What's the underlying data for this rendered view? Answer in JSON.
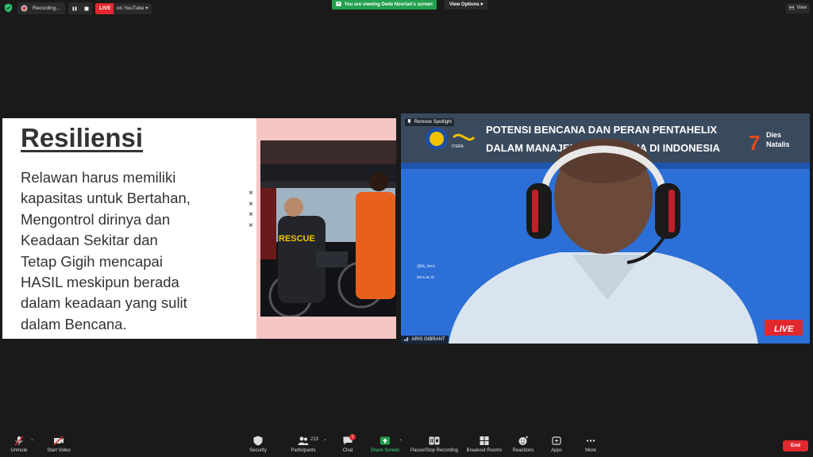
{
  "topbar": {
    "recording_label": "Recording...",
    "pause_icon": "pause-icon",
    "stop_icon": "stop-icon",
    "live_badge": "LIVE",
    "stream_label": "on YouTube",
    "viewing_banner": "You are viewing Dede Novrian's screen",
    "view_options": "View Options",
    "view_button": "View"
  },
  "slide": {
    "title": "Resiliensi",
    "body_lines": [
      "Relawan harus memiliki",
      "kapasitas untuk Bertahan,",
      "Mengontrol dirinya dan",
      "Keadaan Sekitar dan",
      "Tetap Gigih mencapai",
      "HASIL meskipun berada",
      "dalam keadaan yang sulit",
      "dalam Bencana."
    ],
    "bullets": [
      "×",
      "×",
      "×",
      "×"
    ],
    "photo_vest_text": "RESCUE"
  },
  "speaker": {
    "remove_spotlight": "Remove Spotlight",
    "name": "ARIS GIBRANT",
    "banner_line1": "POTENSI BENCANA DAN PERAN PENTAHELIX",
    "banner_line2": "DALAM MANAJEMEN BENCANA DI INDONESIA",
    "logo_text": "ITERA",
    "dies_line1": "Dies",
    "dies_line2": "Natalis",
    "dies_number": "7",
    "social1": "@itk_itera",
    "social2": "itera.ac.id",
    "live_badge": "LIVE"
  },
  "toolbar": {
    "unmute": "Unmute",
    "start_video": "Start Video",
    "security": "Security",
    "participants": "Participants",
    "participants_count": "213",
    "chat": "Chat",
    "chat_badge": "1",
    "share_screen": "Share Screen",
    "pause_stop_recording": "Pause/Stop Recording",
    "breakout_rooms": "Breakout Rooms",
    "reactions": "Reactions",
    "apps": "Apps",
    "more": "More",
    "end": "End"
  },
  "colors": {
    "background": "#1a1a1a",
    "live_red": "#e0282e",
    "share_green": "#23a14d",
    "slide_pink": "#f6c6c4",
    "speaker_blue": "#2c6fd6"
  }
}
